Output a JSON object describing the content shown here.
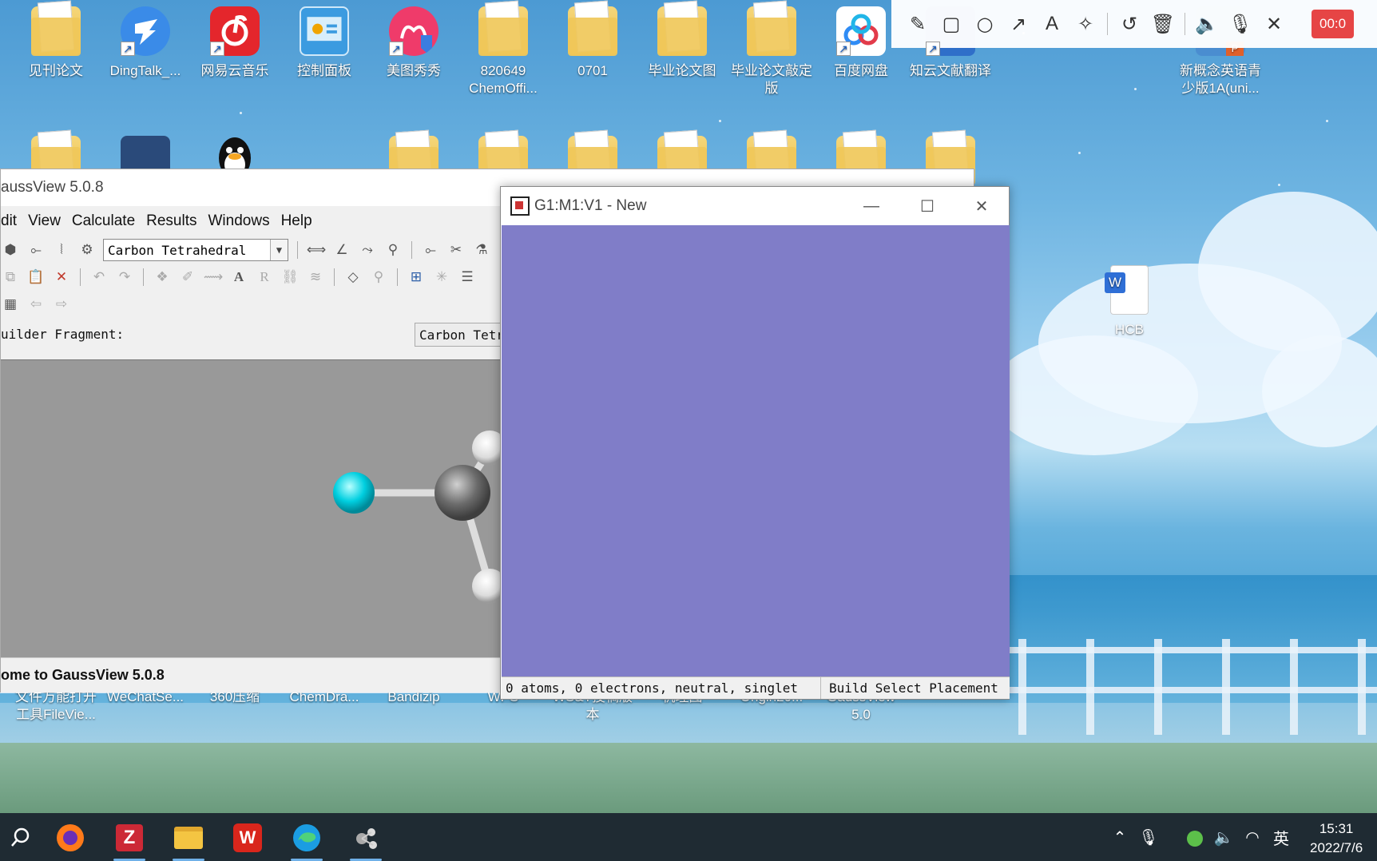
{
  "desktop": {
    "icons_top": [
      {
        "label": "见刊论文",
        "type": "folder"
      },
      {
        "label": "DingTalk_...",
        "type": "app"
      },
      {
        "label": "网易云音乐",
        "type": "app"
      },
      {
        "label": "控制面板",
        "type": "app"
      },
      {
        "label": "美图秀秀",
        "type": "app"
      },
      {
        "label": "820649 ChemOffi...",
        "type": "folder"
      },
      {
        "label": "0701",
        "type": "folder"
      },
      {
        "label": "毕业论文图",
        "type": "folder"
      },
      {
        "label": "毕业论文敲定版",
        "type": "folder"
      },
      {
        "label": "百度网盘",
        "type": "app"
      },
      {
        "label": "知云文献翻译",
        "type": "app"
      },
      {
        "label": "新概念英语青少版1A(uni...",
        "type": "app"
      }
    ],
    "icons_bottom": [
      {
        "label": "文件万能打开工具FileVie..."
      },
      {
        "label": "WeChatSe..."
      },
      {
        "label": "360压缩"
      },
      {
        "label": "ChemDra..."
      },
      {
        "label": "Bandizip"
      },
      {
        "label": "WPS"
      },
      {
        "label": "WS&T投稿版本"
      },
      {
        "label": "机理图"
      },
      {
        "label": "Origin20..."
      },
      {
        "label": "GaussView 5.0"
      }
    ],
    "hcb_icon_label": "HCB"
  },
  "recorder": {
    "time": "00:0",
    "colors": {
      "record": "#e64545"
    }
  },
  "gaussview": {
    "title": "aussView 5.0.8",
    "menu": [
      "dit",
      "View",
      "Calculate",
      "Results",
      "Windows",
      "Help"
    ],
    "fragment_combo": "Carbon Tetrahedral",
    "builder_label": "uilder Fragment:",
    "builder_fragment_value": "Carbon Tetr",
    "status": "ome to GaussView 5.0.8"
  },
  "g1window": {
    "title": "G1:M1:V1 - New",
    "canvas_color": "#807dc8",
    "status_left": "0 atoms, 0 electrons, neutral, singlet",
    "status_right": "Build Select Placement"
  },
  "taskbar": {
    "apps": [
      "search-icon",
      "firefox-icon",
      "zotero-icon",
      "file-explorer-icon",
      "wps-icon",
      "edge-icon",
      "gaussview-icon"
    ],
    "tray": {
      "ime": "英"
    },
    "clock": {
      "time": "15:31",
      "date": "2022/7/6"
    }
  }
}
